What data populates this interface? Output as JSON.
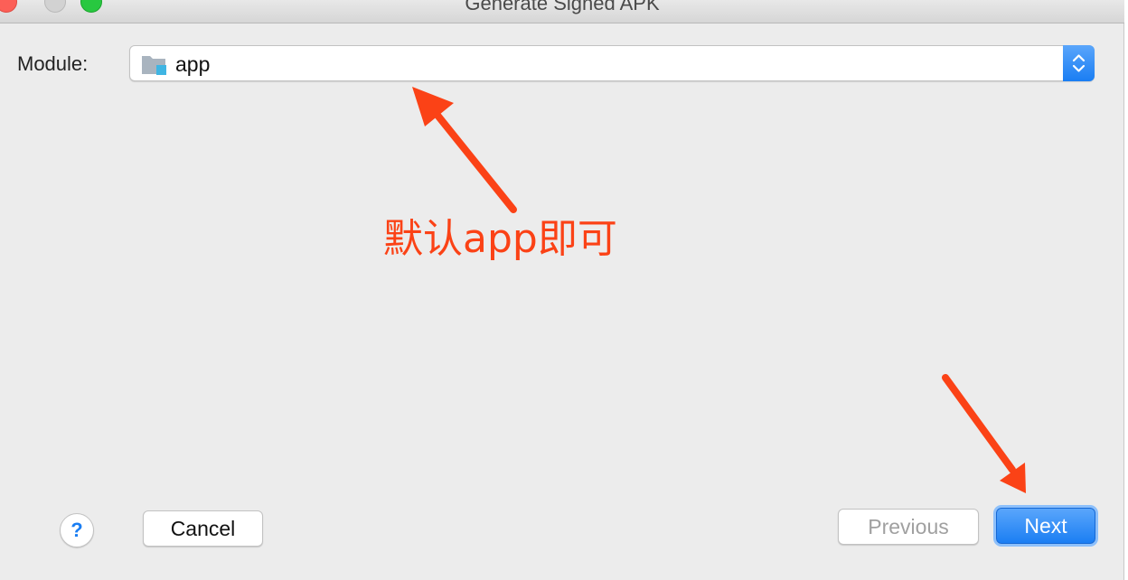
{
  "window": {
    "title": "Generate Signed APK"
  },
  "form": {
    "module_label": "Module:",
    "module_value": "app"
  },
  "annotation": {
    "text": "默认app即可",
    "color": "#fb4216"
  },
  "buttons": {
    "help": "?",
    "cancel": "Cancel",
    "previous": "Previous",
    "next": "Next"
  },
  "colors": {
    "accent": "#1a7ef3",
    "window_bg": "#ececec",
    "close": "#fc5f57",
    "maximize": "#28c840"
  },
  "icons": {
    "module": "folder-module-icon",
    "stepper": "up-down-chevron-icon",
    "help": "question-mark-icon"
  }
}
